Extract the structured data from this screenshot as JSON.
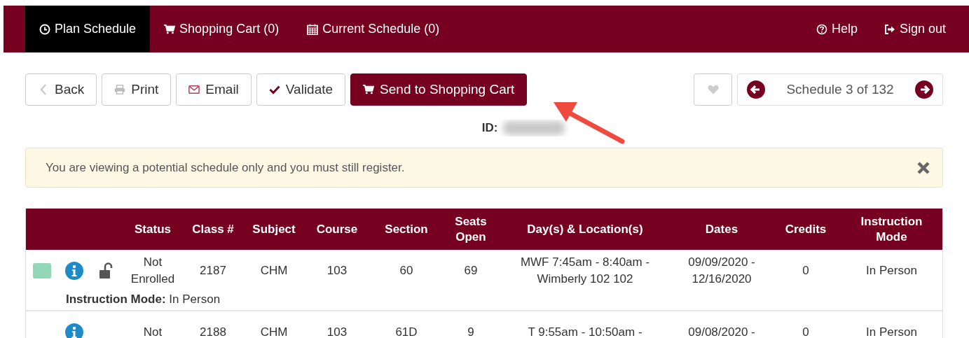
{
  "nav": {
    "tabs": [
      {
        "label": "Plan Schedule",
        "selected": true
      },
      {
        "label": "Shopping Cart (0)",
        "selected": false
      },
      {
        "label": "Current Schedule (0)",
        "selected": false
      }
    ],
    "links": [
      {
        "label": "Help"
      },
      {
        "label": "Sign out"
      }
    ]
  },
  "toolbar": [
    {
      "label": "Back",
      "kind": "default"
    },
    {
      "label": "Print",
      "kind": "default"
    },
    {
      "label": "Email",
      "kind": "default"
    },
    {
      "label": "Validate",
      "kind": "default"
    },
    {
      "label": "Send to Shopping Cart",
      "kind": "primary"
    }
  ],
  "pager": {
    "label": "Schedule 3 of 132"
  },
  "id_label": "ID:",
  "alert": {
    "message": "You are viewing a potential schedule only and you must still register."
  },
  "table": {
    "columns": [
      "Status",
      "Class #",
      "Subject",
      "Course",
      "Section",
      "Seats Open",
      "Day(s) & Location(s)",
      "Dates",
      "Credits",
      "Instruction Mode"
    ],
    "rows": [
      {
        "color": "#93d8b6",
        "locked": false,
        "cells": [
          "Not Enrolled",
          "2187",
          "CHM",
          "103",
          "60",
          "69",
          "MWF 7:45am - 8:40am - Wimberly 102 102",
          "09/09/2020 - 12/16/2020",
          "0",
          "In Person"
        ],
        "detail": "**Instruction Mode:** In Person"
      },
      {
        "cells": [
          "Not",
          "2188",
          "CHM",
          "103",
          "61D",
          "9",
          "T 9:55am - 10:50am -",
          "09/08/2020 -",
          "0",
          "In Person"
        ]
      }
    ]
  }
}
